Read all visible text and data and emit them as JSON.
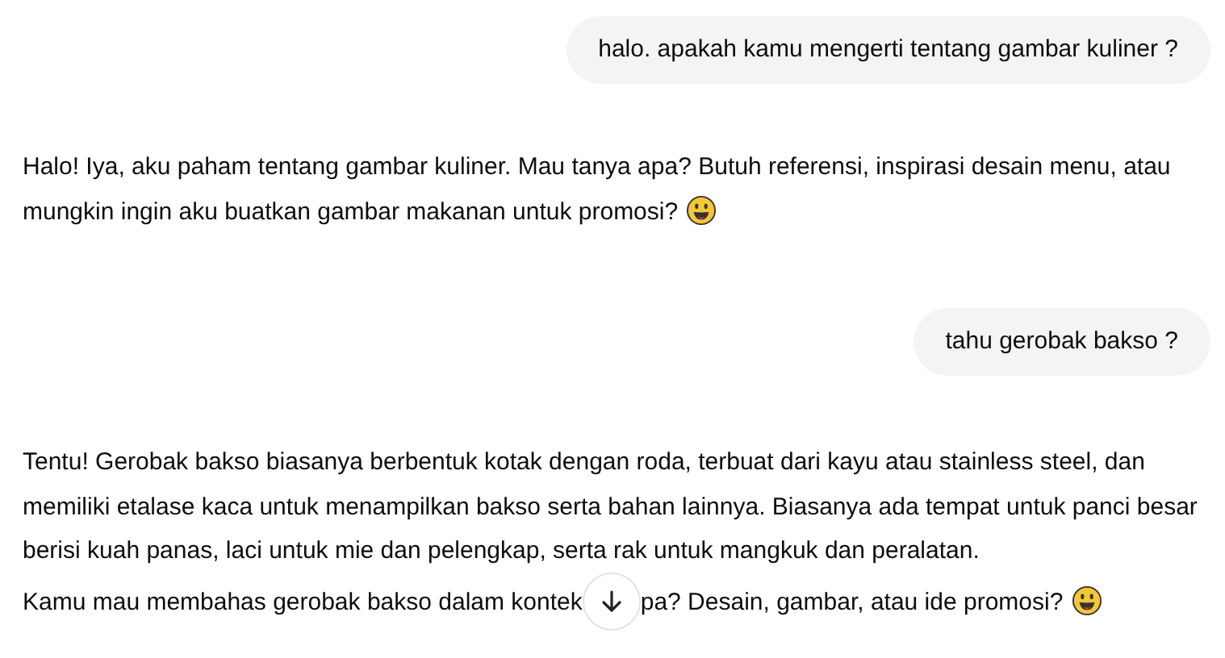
{
  "messages": [
    {
      "kind": "user",
      "text": "halo. apakah kamu mengerti tentang gambar kuliner ?"
    },
    {
      "kind": "assistant",
      "paragraphs": [
        {
          "parts": [
            "Halo! Iya, aku paham tentang gambar kuliner. Mau tanya apa? Butuh referensi, inspirasi desain menu, atau mungkin ingin aku buatkan gambar makanan untuk promosi?"
          ],
          "emoji": true
        }
      ]
    },
    {
      "kind": "user",
      "text": "tahu gerobak bakso ?"
    },
    {
      "kind": "assistant",
      "paragraphs": [
        {
          "parts": [
            "Tentu! Gerobak bakso biasanya berbentuk kotak dengan roda, terbuat dari kayu atau stainless steel, dan memiliki etalase kaca untuk menampilkan bakso serta bahan lainnya. Biasanya ada tempat untuk panci besar berisi kuah panas, laci untuk mie dan pelengkap, serta rak untuk mangkuk dan peralatan."
          ],
          "emoji": false
        },
        {
          "parts": [
            "Kamu mau membahas gerobak bakso dalam kontek",
            "pa? Desain, gambar, atau ide promosi?"
          ],
          "emoji": true
        }
      ]
    }
  ]
}
